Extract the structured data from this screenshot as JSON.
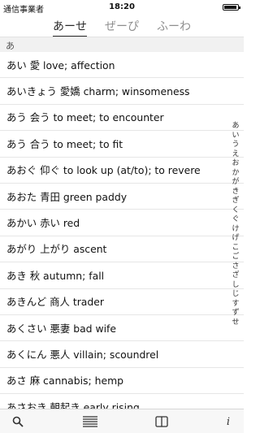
{
  "status": {
    "carrier": "通信事業者",
    "time": "18:20"
  },
  "tabs": [
    {
      "label": "あーせ",
      "active": true
    },
    {
      "label": "ぜーぴ",
      "active": false
    },
    {
      "label": "ふーわ",
      "active": false
    }
  ],
  "section": "あ",
  "entries": [
    "あい 愛 love; affection",
    "あいきょう 愛嬌 charm; winsomeness",
    "あう 会う to meet; to encounter",
    "あう 合う to meet; to fit",
    "あおぐ 仰ぐ to look up (at/to); to revere",
    "あおた 青田 green paddy",
    "あかい 赤い red",
    "あがり 上がり ascent",
    "あき 秋 autumn; fall",
    "あきんど 商人 trader",
    "あくさい 悪妻 bad wife",
    "あくにん 悪人 villain; scoundrel",
    "あさ 麻 cannabis; hemp",
    "あさおき 朝起き early rising"
  ],
  "index": [
    "あ",
    "い",
    "う",
    "え",
    "お",
    "か",
    "が",
    "き",
    "ぎ",
    "く",
    "ぐ",
    "け",
    "げ",
    "こ",
    "ご",
    "さ",
    "ざ",
    "し",
    "じ",
    "す",
    "ず",
    "せ"
  ],
  "toolbar": {
    "icons": [
      "search-icon",
      "list-icon",
      "book-icon",
      "info-icon"
    ],
    "info_glyph": "i"
  }
}
